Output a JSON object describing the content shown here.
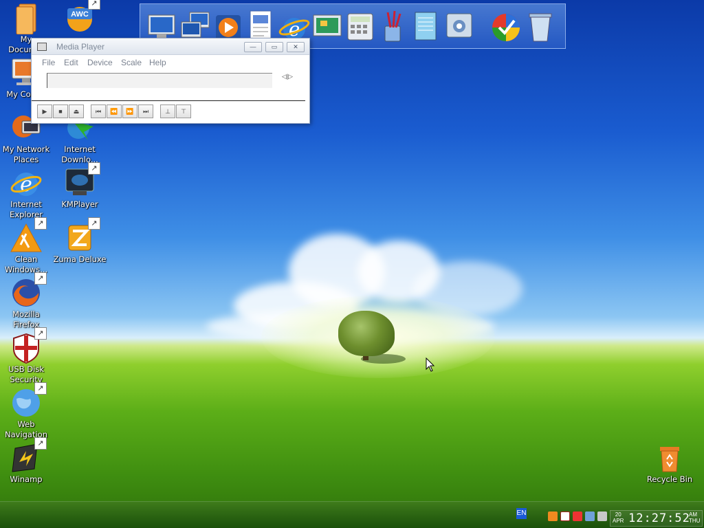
{
  "window": {
    "title": "Media Player",
    "menu": [
      "File",
      "Edit",
      "Device",
      "Scale",
      "Help"
    ]
  },
  "desktop_icons": [
    {
      "label": "My Documents",
      "label_visible": "My\nDocum..."
    },
    {
      "label": "AWC"
    },
    {
      "label": "My Computer",
      "label_visible": "My Com..."
    },
    {
      "label": "My Network Places",
      "label_visible": "My Network\nPlaces"
    },
    {
      "label": "Internet Download...",
      "label_visible": "Internet\nDownlo..."
    },
    {
      "label": "Internet Explorer",
      "label_visible": "Internet\nExplorer"
    },
    {
      "label": "KMPlayer",
      "label_visible": "KMPlayer"
    },
    {
      "label": "Clean Windows...",
      "label_visible": "Clean\nWindows..."
    },
    {
      "label": "Zuma Deluxe",
      "label_visible": "Zuma Deluxe"
    },
    {
      "label": "Mozilla Firefox",
      "label_visible": "Mozilla\nFirefox"
    },
    {
      "label": "USB Disk Security",
      "label_visible": "USB Disk\nSecurity"
    },
    {
      "label": "Web Navigation",
      "label_visible": "Web\nNavigation"
    },
    {
      "label": "Winamp",
      "label_visible": "Winamp"
    },
    {
      "label": "Recycle Bin",
      "label_visible": "Recycle Bin"
    }
  ],
  "taskbar": {
    "language": "EN",
    "clock": {
      "day": "20",
      "month": "APR",
      "time": "12:27:52",
      "ampm": "AM",
      "weekday": "THU"
    }
  }
}
